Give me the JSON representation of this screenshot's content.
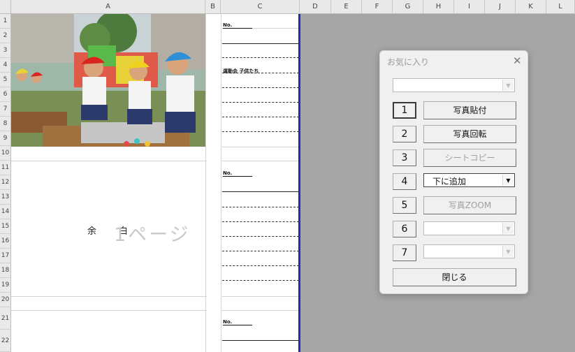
{
  "columns": [
    "A",
    "B",
    "C",
    "D",
    "E",
    "F",
    "G",
    "H",
    "I",
    "J",
    "K",
    "L"
  ],
  "rows": [
    "1",
    "2",
    "3",
    "4",
    "5",
    "6",
    "7",
    "8",
    "9",
    "10",
    "11",
    "12",
    "13",
    "14",
    "15",
    "16",
    "17",
    "18",
    "19",
    "20",
    "21",
    "22"
  ],
  "cells": {
    "c1_text": "No.",
    "c4_text": "運動会 子供たち",
    "c11_text": "No.",
    "c21_text": "No."
  },
  "watermark": {
    "yohaku_1": "余",
    "yohaku_2": "白",
    "page_label": "1ページ"
  },
  "dialog": {
    "title": "お気に入り",
    "close_glyph": "✕",
    "top_combo_value": "",
    "buttons": [
      {
        "num": "1",
        "label": "写真貼付",
        "enabled": true
      },
      {
        "num": "2",
        "label": "写真回転",
        "enabled": true
      },
      {
        "num": "3",
        "label": "シートコピー",
        "enabled": false
      },
      {
        "num": "4",
        "combo_value": "下に追加"
      },
      {
        "num": "5",
        "label": "写真ZOOM",
        "enabled": false
      },
      {
        "num": "6",
        "combo_value": ""
      },
      {
        "num": "7",
        "combo_value": ""
      }
    ],
    "close_label": "閉じる",
    "dropdown_glyph": "▼"
  },
  "colors": {
    "sheet_border_blue": "#1f2db0",
    "background_gray": "#a6a6a6"
  }
}
